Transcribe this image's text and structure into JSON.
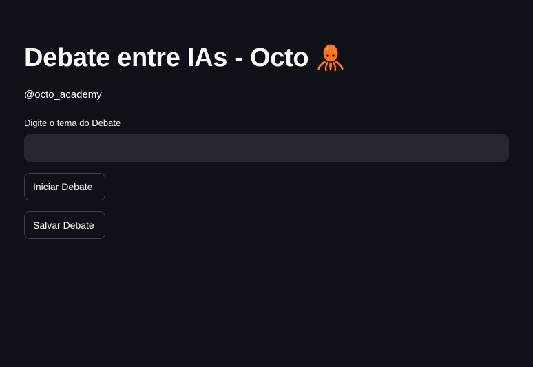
{
  "header": {
    "title": "Debate entre IAs - Octo",
    "title_icon": "octopus-icon",
    "subtitle": "@octo_academy"
  },
  "form": {
    "topic_label": "Digite o tema do Debate",
    "topic_value": "",
    "topic_placeholder": ""
  },
  "actions": {
    "start_label": "Iniciar Debate",
    "save_label": "Salvar Debate"
  },
  "colors": {
    "background": "#0e1117",
    "input_background": "#262730",
    "text": "#fafafa",
    "button_border": "#3d404a",
    "octopus": "#f4761f"
  }
}
